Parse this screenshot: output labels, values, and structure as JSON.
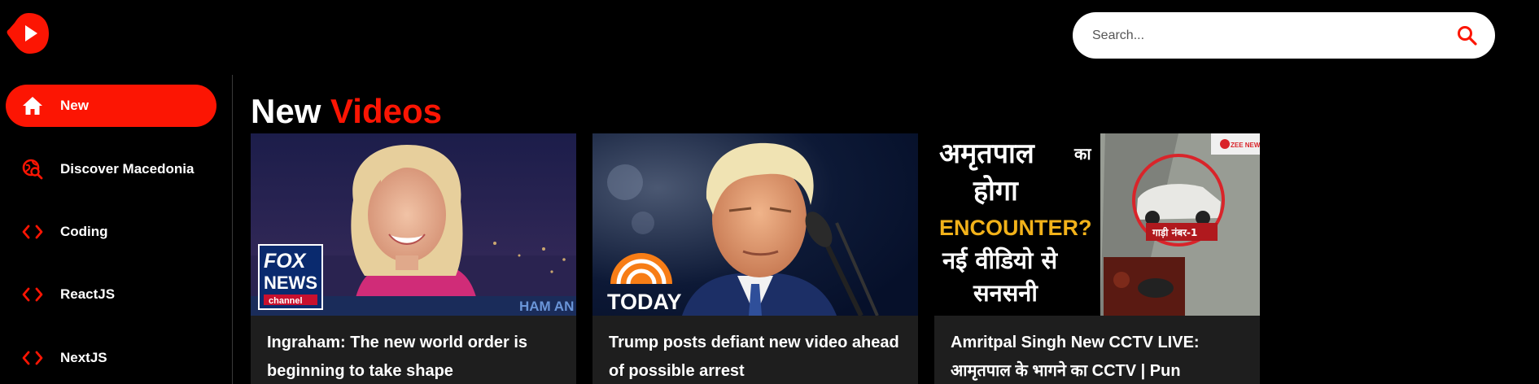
{
  "logo": {
    "icon": "play-logo-icon",
    "color": "#fc1503"
  },
  "search": {
    "placeholder": "Search...",
    "icon": "search-icon"
  },
  "sidebar": {
    "items": [
      {
        "label": "New",
        "icon": "home-icon",
        "active": true
      },
      {
        "label": "Discover Macedonia",
        "icon": "globe-search-icon",
        "active": false
      },
      {
        "label": "Coding",
        "icon": "code-icon",
        "active": false
      },
      {
        "label": "ReactJS",
        "icon": "code-icon",
        "active": false
      },
      {
        "label": "NextJS",
        "icon": "code-icon",
        "active": false
      }
    ]
  },
  "feed": {
    "title_primary": "New",
    "title_accent": "Videos",
    "accent_color": "#fc1503",
    "videos": [
      {
        "title": "Ingraham: The new world order is beginning to take shape",
        "thumb_logo_line1": "FOX",
        "thumb_logo_line2": "NEWS",
        "thumb_logo_line3": "channel",
        "thumb_ticker": "HAM AN"
      },
      {
        "title": "Trump posts defiant new video ahead of possible arrest",
        "thumb_logo": "TODAY"
      },
      {
        "title": "Amritpal Singh New CCTV LIVE: आमृतपाल के भागने का CCTV | Pun",
        "thumb_line1": "अमृतपाल",
        "thumb_line1b": "का",
        "thumb_line2": "होगा",
        "thumb_line3": "ENCOUNTER?",
        "thumb_line4": "नई वीडियो से",
        "thumb_line5": "सनसनी",
        "thumb_tag": "गाड़ी नंबर-1",
        "thumb_badge": "ZEE NEWS"
      }
    ]
  },
  "colors": {
    "background": "#000000",
    "card": "#1e1e1e",
    "accent": "#fc1503"
  }
}
